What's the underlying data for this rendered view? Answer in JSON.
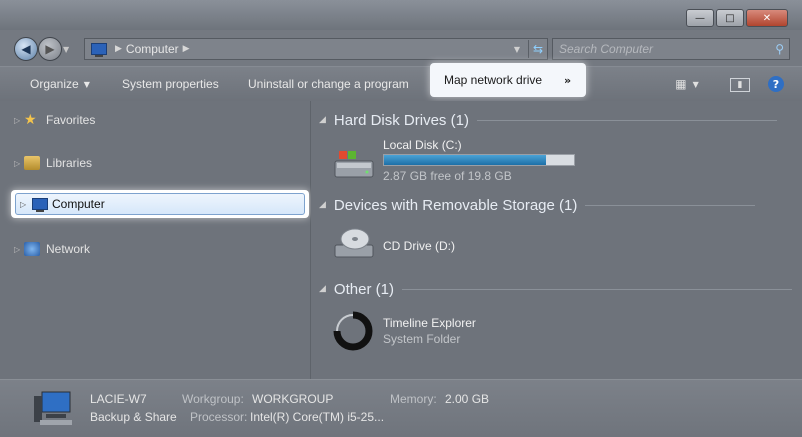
{
  "address": {
    "crumbs": [
      "Computer"
    ]
  },
  "search": {
    "placeholder": "Search Computer"
  },
  "toolbar": {
    "organize": "Organize",
    "system_properties": "System properties",
    "uninstall": "Uninstall or change a program",
    "map_network_drive": "Map network drive",
    "more": "»"
  },
  "nav": {
    "favorites": "Favorites",
    "libraries": "Libraries",
    "computer": "Computer",
    "network": "Network"
  },
  "content": {
    "groups": [
      {
        "title": "Hard Disk Drives (1)"
      },
      {
        "title": "Devices with Removable Storage (1)"
      },
      {
        "title": "Other (1)"
      }
    ],
    "local_disk": {
      "name": "Local Disk (C:)",
      "free_text": "2.87 GB free of 19.8 GB",
      "used_fraction": 0.855
    },
    "cd_drive": {
      "name": "CD Drive (D:)"
    },
    "timeline": {
      "name": "Timeline Explorer",
      "type": "System Folder"
    }
  },
  "details": {
    "computer_name": "LACIE-W7",
    "backup": "Backup & Share",
    "workgroup_label": "Workgroup:",
    "workgroup_value": "WORKGROUP",
    "processor_label": "Processor:",
    "processor_value": "Intel(R) Core(TM) i5-25...",
    "memory_label": "Memory:",
    "memory_value": "2.00 GB"
  }
}
